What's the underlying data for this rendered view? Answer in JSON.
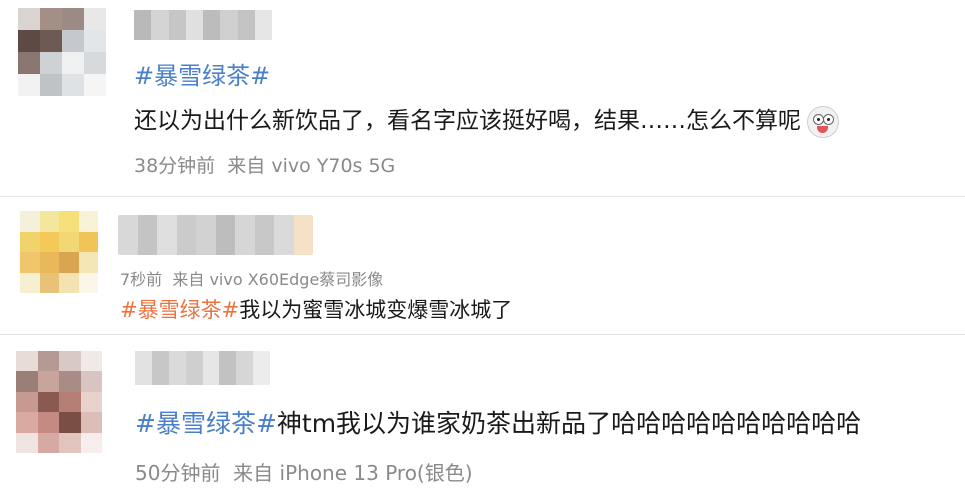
{
  "theme": {
    "hashtag_blue": "#4a7fc9",
    "hashtag_orange": "#eb7340",
    "text_color": "#1a1a1a",
    "meta_color": "#8a8a8a"
  },
  "comments": [
    {
      "hashtag": "#暴雪绿茶#",
      "body": "还以为出什么新饮品了，看名字应该挺好喝，结果……怎么不算呢",
      "emoji": "dizzy-face-tongue-emoji",
      "time": "38分钟前",
      "source": "来自 vivo Y70s 5G"
    },
    {
      "time": "7秒前",
      "source": "来自 vivo X60Edge蔡司影像",
      "hashtag": "#暴雪绿茶#",
      "body": "我以为蜜雪冰城变爆雪冰城了"
    },
    {
      "hashtag": "#暴雪绿茶#",
      "body": "神tm我以为谁家奶茶出新品了哈哈哈哈哈哈哈哈哈哈",
      "time": "50分钟前",
      "source": "来自 iPhone 13 Pro(银色)"
    }
  ]
}
